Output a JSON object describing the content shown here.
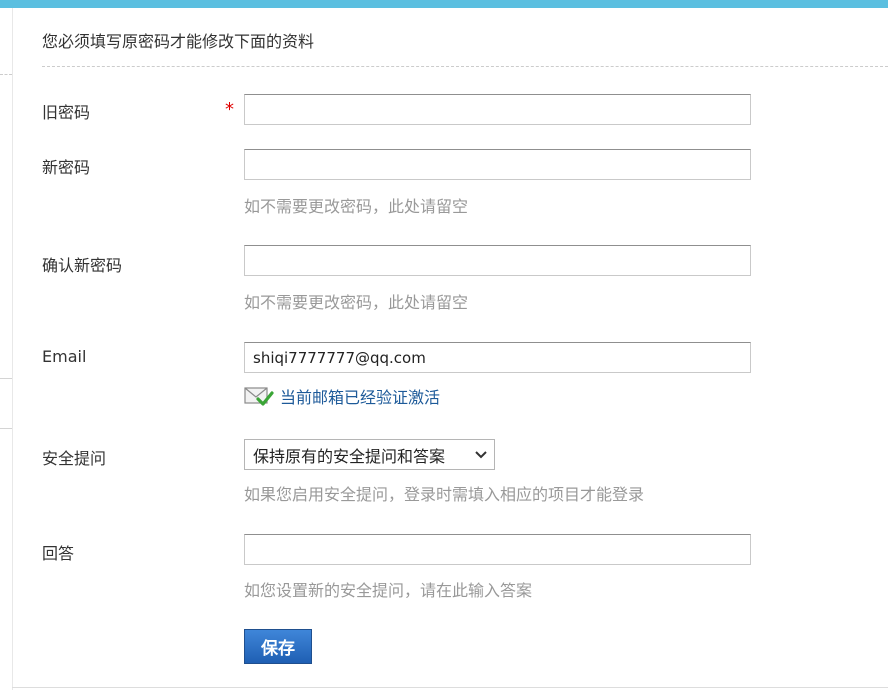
{
  "notice": "您必须填写原密码才能修改下面的资料",
  "required_mark": "*",
  "old_password": {
    "label": "旧密码",
    "value": ""
  },
  "new_password": {
    "label": "新密码",
    "value": "",
    "hint": "如不需要更改密码，此处请留空"
  },
  "confirm_password": {
    "label": "确认新密码",
    "value": "",
    "hint": "如不需要更改密码，此处请留空"
  },
  "email": {
    "label": "Email",
    "value": "shiqi7777777@qq.com",
    "status_text": "当前邮箱已经验证激活",
    "status_icon": "envelope-check-icon"
  },
  "security_question": {
    "label": "安全提问",
    "selected": "保持原有的安全提问和答案",
    "hint": "如果您启用安全提问，登录时需填入相应的项目才能登录"
  },
  "answer": {
    "label": "回答",
    "value": "",
    "hint": "如您设置新的安全提问，请在此输入答案"
  },
  "save_label": "保存",
  "colors": {
    "topbar": "#5bbfe0",
    "required": "#e00000",
    "link": "#1d5a99",
    "hint": "#999999",
    "button": "#2a6fc4"
  }
}
